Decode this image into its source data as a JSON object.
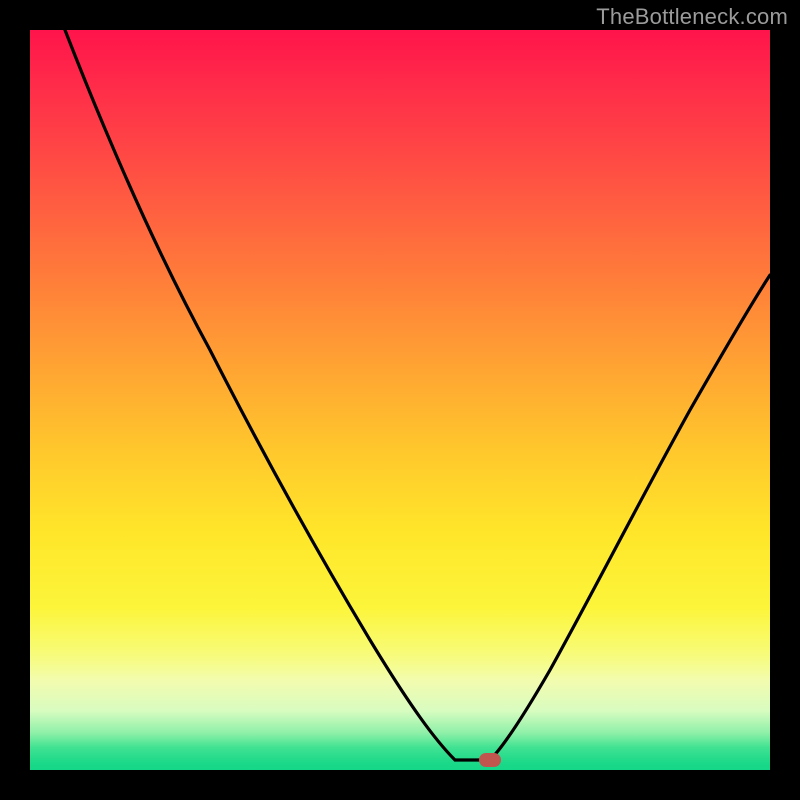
{
  "watermark": "TheBottleneck.com",
  "colors": {
    "frame": "#000000",
    "curve": "#000000",
    "marker": "#c1564f"
  },
  "chart_data": {
    "type": "line",
    "title": "",
    "xlabel": "",
    "ylabel": "",
    "xlim": [
      0,
      100
    ],
    "ylim": [
      0,
      100
    ],
    "x": [
      0,
      3,
      8,
      15,
      22,
      30,
      36,
      42,
      47,
      52,
      55,
      58,
      60,
      62,
      65,
      70,
      76,
      82,
      88,
      94,
      100
    ],
    "values": [
      100,
      95,
      88,
      78,
      67,
      54,
      44,
      33,
      23,
      13,
      7,
      2,
      0,
      0,
      3,
      12,
      24,
      37,
      49,
      59,
      67
    ],
    "marker": {
      "x": 62,
      "y": 0
    },
    "gradient_stops": [
      {
        "pos": 0,
        "color": "#ff144b"
      },
      {
        "pos": 50,
        "color": "#ffc82c"
      },
      {
        "pos": 85,
        "color": "#f8fb75"
      },
      {
        "pos": 100,
        "color": "#15d788"
      }
    ]
  }
}
